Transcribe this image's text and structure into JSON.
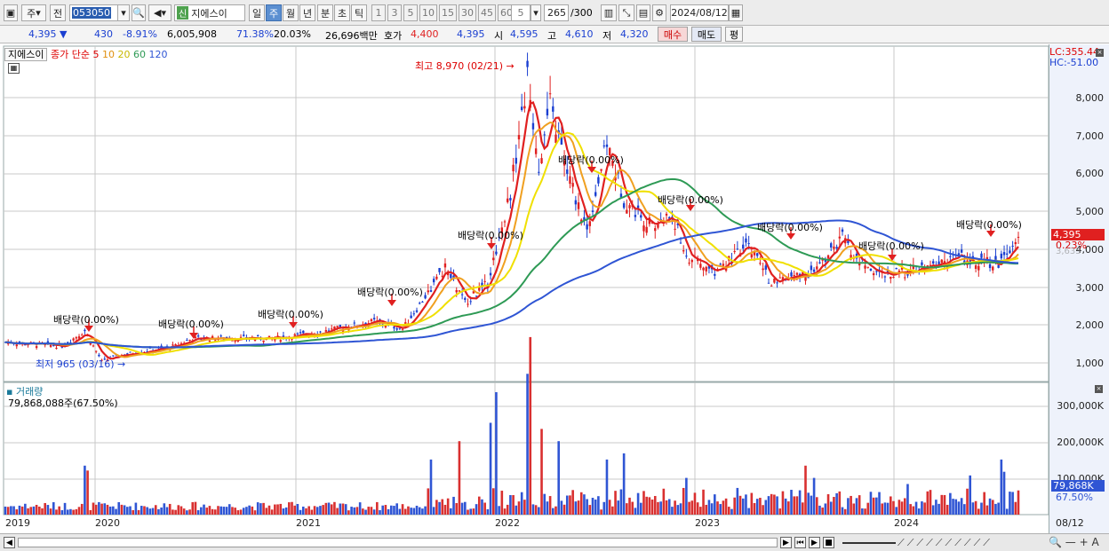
{
  "toolbar": {
    "type_label": "주",
    "prev_label": "전",
    "code": "053050",
    "stock_name": "지에스이",
    "stock_tag": "신",
    "periods": [
      "일",
      "주",
      "월",
      "년",
      "분",
      "초",
      "틱"
    ],
    "selected_period": "주",
    "intervals": [
      "1",
      "3",
      "5",
      "10",
      "15",
      "30",
      "45",
      "60"
    ],
    "interval_value": "5",
    "count": "265",
    "count_total": "/300",
    "date": "2024/08/12"
  },
  "quote": {
    "price": "4,395",
    "change_arrow": "▼",
    "change": "430",
    "change_pct": "-8.91%",
    "volume": "6,005,908",
    "turnover_pct": "71.38%",
    "foreign_pct": "20.03%",
    "amount": "26,696백만",
    "bid_label": "호가",
    "bid": "4,400",
    "ask": "4,395",
    "open_label": "시",
    "open": "4,595",
    "high_label": "고",
    "high": "4,610",
    "low_label": "저",
    "low": "4,320",
    "buy_label": "매수",
    "sell_label": "매도",
    "eval_label": "평"
  },
  "legend": {
    "name": "지에스이",
    "ma_label": "종가 단순",
    "ma": [
      "5",
      "10",
      "20",
      "60",
      "120"
    ],
    "ma_colors": [
      "#e02020",
      "#f0a020",
      "#f0e000",
      "#2e9a55",
      "#2f55d4"
    ]
  },
  "price_axis": [
    "8,000",
    "7,000",
    "6,000",
    "5,000",
    "4,000",
    "3,000",
    "2,000",
    "1,000"
  ],
  "lc_label": "LC:355.44",
  "hc_label": "HC:-51.00",
  "current_price_tag": "4,395",
  "current_pct_tag": "0.23%",
  "current_pct_tag2": "3,635",
  "high_note": "최고 8,970 (02/21)",
  "low_note": "최저 965 (03/16)",
  "dividend_label": "배당락(0.00%)",
  "volume_panel": {
    "title": "거래량",
    "total": "79,868,088주(67.50%)",
    "axis": [
      "300,000K",
      "200,000K",
      "100,000K"
    ],
    "current_tag": "79,868K",
    "current_pct": "67.50%"
  },
  "x_axis": [
    "2019",
    "2020",
    "2021",
    "2022",
    "2023",
    "2024",
    "08/12"
  ],
  "colors": {
    "up": "#e02020",
    "down": "#1a3fd1",
    "ma5": "#e02020",
    "ma10": "#f0a020",
    "ma20": "#f0e000",
    "ma60": "#2e9a55",
    "ma120": "#2f55d4"
  }
}
